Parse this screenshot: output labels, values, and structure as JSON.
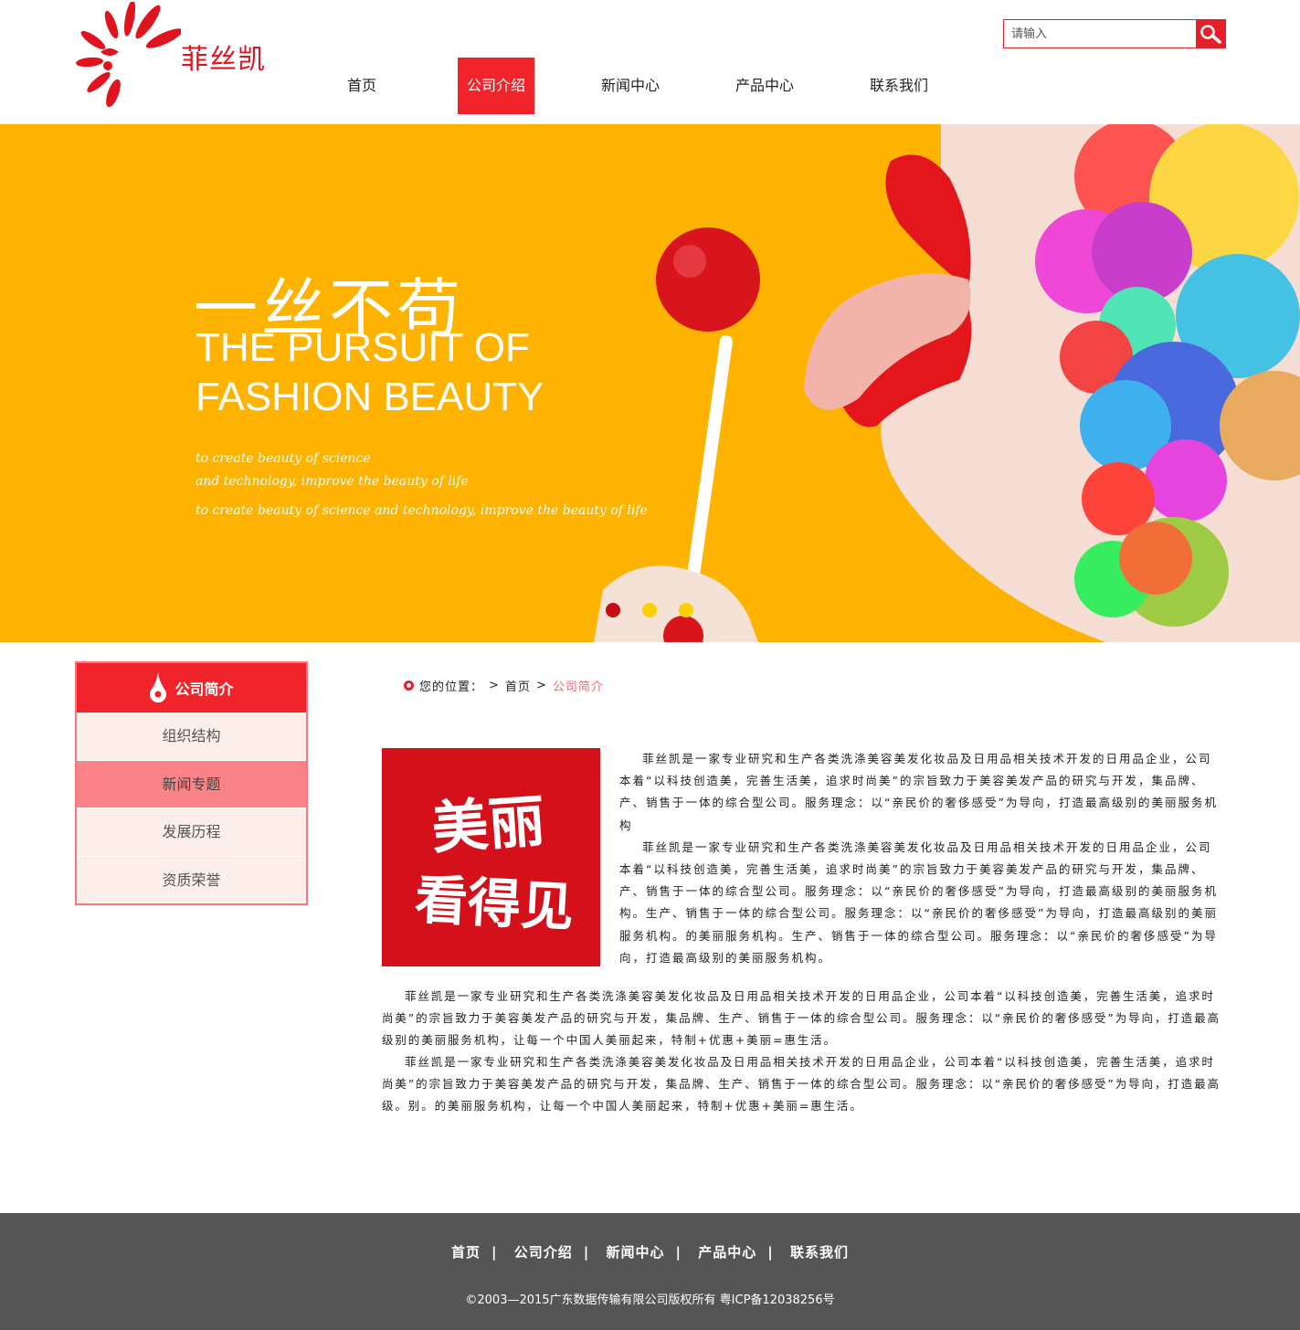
{
  "brand": {
    "name": "菲丝凯"
  },
  "search": {
    "placeholder": "请输入"
  },
  "nav": {
    "items": [
      "首页",
      "公司介绍",
      "新闻中心",
      "产品中心",
      "联系我们"
    ],
    "active": "公司介绍"
  },
  "banner": {
    "headline": "一丝不苟",
    "title_line1": "THE PURSUIT OF",
    "title_line2": "FASHION BEAUTY",
    "sub_line1": "to create beauty of science",
    "sub_line2": "and technology, improve the beauty of life",
    "sub_line3": "to create beauty of science and technology, improve the beauty of life",
    "active_dot": 1
  },
  "sidebar": {
    "title": "公司简介",
    "items": [
      "组织结构",
      "新闻专题",
      "发展历程",
      "资质荣誉"
    ],
    "highlighted": "新闻专题"
  },
  "breadcrumb": {
    "prefix": "您的位置：",
    "home": "首页",
    "current": "公司简介"
  },
  "content": {
    "image_text": "美丽看得见",
    "para1": "菲丝凯是一家专业研究和生产各类洗涤美容美发化妆品及日用品相关技术开发的日用品企业，公司本着“以科技创造美，完善生活美，追求时尚美”的宗旨致力于美容美发产品的研究与开发，集品牌、产、销售于一体的综合型公司。服务理念：以“亲民价的奢侈感受”为导向，打造最高级别的美丽服务机构",
    "para2": "菲丝凯是一家专业研究和生产各类洗涤美容美发化妆品及日用品相关技术开发的日用品企业，公司本着“以科技创造美，完善生活美，追求时尚美”的宗旨致力于美容美发产品的研究与开发，集品牌、产、销售于一体的综合型公司。服务理念：以“亲民价的奢侈感受”为导向，打造最高级别的美丽服务机构。生产、销售于一体的综合型公司。服务理念：以“亲民价的奢侈感受”为导向，打造最高级别的美丽服务机构。的美丽服务机构。生产、销售于一体的综合型公司。服务理念：以“亲民价的奢侈感受”为导向，打造最高级别的美丽服务机构。",
    "para3": "菲丝凯是一家专业研究和生产各类洗涤美容美发化妆品及日用品相关技术开发的日用品企业，公司本着“以科技创造美，完善生活美，追求时尚美”的宗旨致力于美容美发产品的研究与开发，集品牌、生产、销售于一体的综合型公司。服务理念：以“亲民价的奢侈感受”为导向，打造最高级别的美丽服务机构，让每一个中国人美丽起来，特制+优惠+美丽=惠生活。",
    "para4": "菲丝凯是一家专业研究和生产各类洗涤美容美发化妆品及日用品相关技术开发的日用品企业，公司本着“以科技创造美，完善生活美，追求时尚美”的宗旨致力于美容美发产品的研究与开发，集品牌、生产、销售于一体的综合型公司。服务理念：以“亲民价的奢侈感受”为导向，打造最高级。别。的美丽服务机构，让每一个中国人美丽起来，特制+优惠+美丽=惠生活。"
  },
  "footer": {
    "links": [
      "首页",
      "公司介绍",
      "新闻中心",
      "产品中心",
      "联系我们"
    ],
    "separator": "|",
    "copyright": "©2003—2015广东数据传输有限公司版权所有  粤ICP备12038256号"
  },
  "colors": {
    "accent": "#f1242c",
    "banner_bg": "#fdb300",
    "footer_bg": "#555555",
    "sidebar_bg": "#fcefea",
    "sidebar_highlight": "#f98386"
  }
}
